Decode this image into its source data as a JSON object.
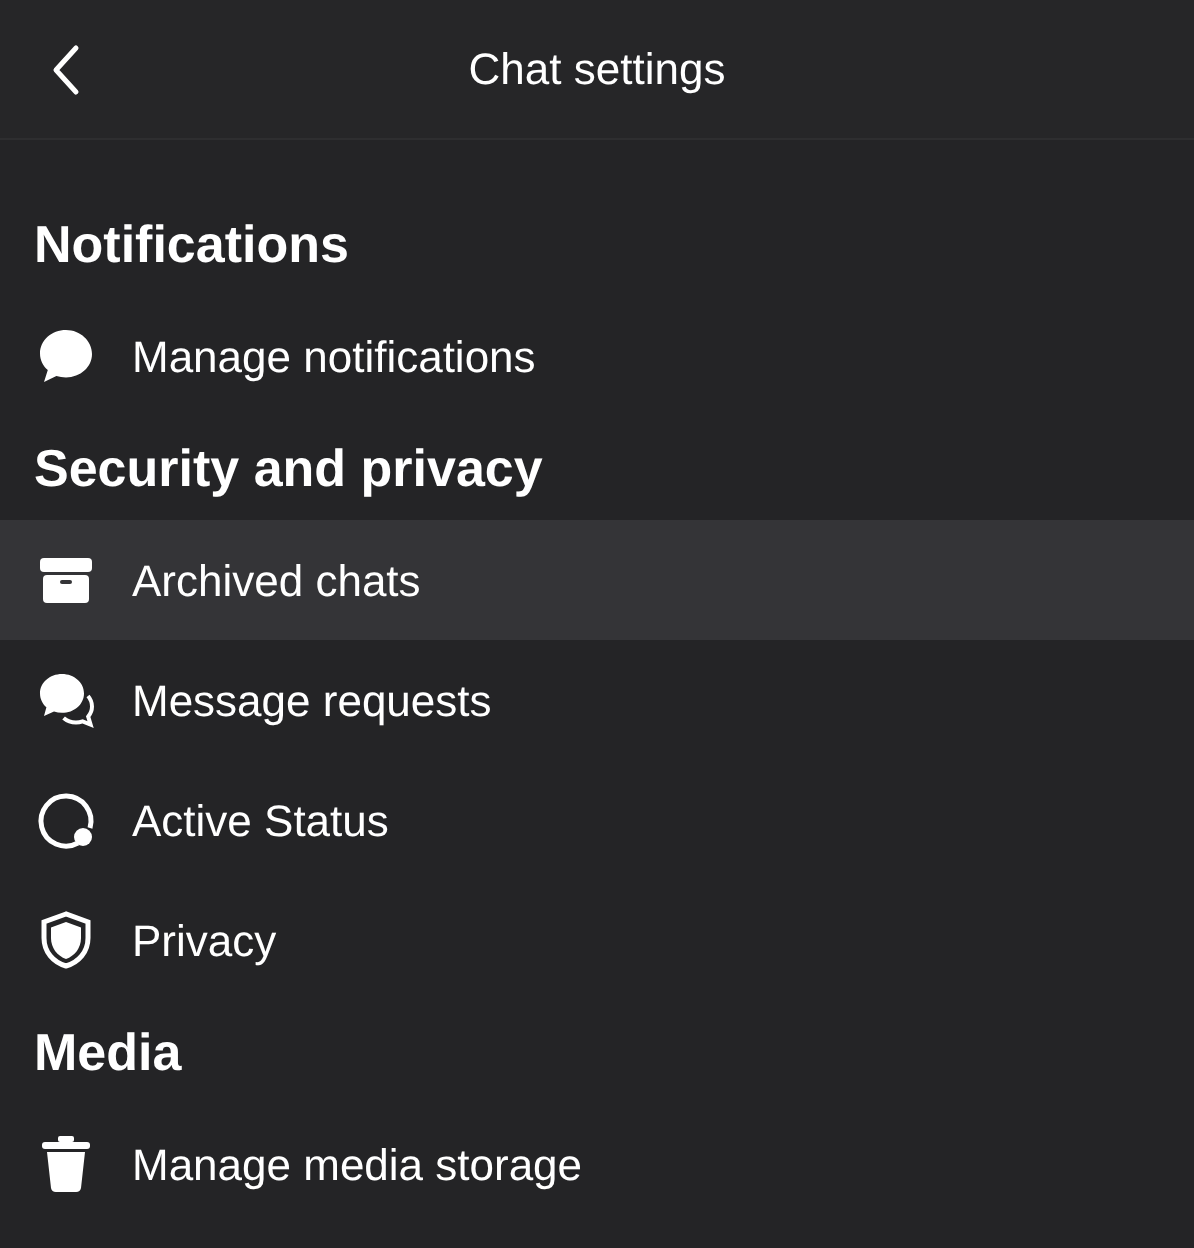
{
  "header": {
    "title": "Chat settings"
  },
  "sections": [
    {
      "title": "Notifications",
      "items": [
        {
          "label": "Manage notifications",
          "kind": "bubble",
          "selected": false
        }
      ]
    },
    {
      "title": "Security and privacy",
      "items": [
        {
          "label": "Archived chats",
          "kind": "archive",
          "selected": true
        },
        {
          "label": "Message requests",
          "kind": "bubbles",
          "selected": false
        },
        {
          "label": "Active Status",
          "kind": "status",
          "selected": false
        },
        {
          "label": "Privacy",
          "kind": "shield",
          "selected": false
        }
      ]
    },
    {
      "title": "Media",
      "items": [
        {
          "label": "Manage media storage",
          "kind": "trash",
          "selected": false
        }
      ]
    }
  ]
}
